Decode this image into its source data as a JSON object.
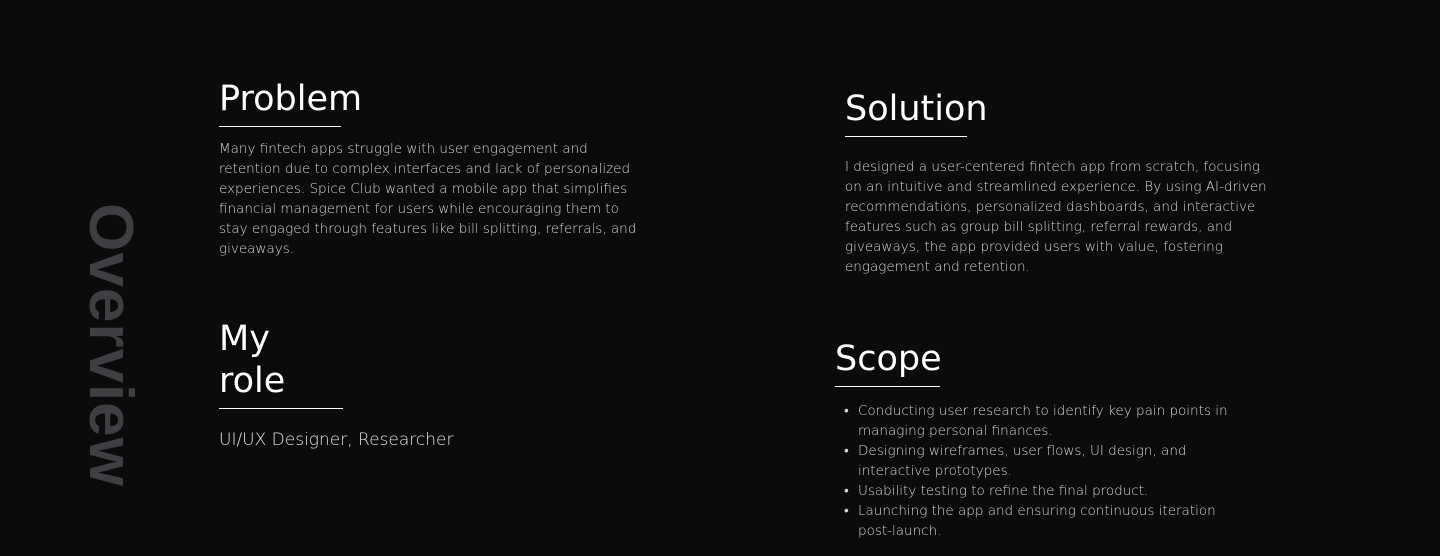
{
  "side_title": "Overview",
  "problem": {
    "heading": "Problem",
    "body": "Many fintech apps struggle with user engagement and retention due to complex interfaces and lack of personalized experiences. Spice Club wanted a mobile app that simplifies financial management for users while encouraging them to stay engaged through features like bill splitting, referrals, and giveaways."
  },
  "solution": {
    "heading": "Solution",
    "body": "I designed a user-centered fintech app from scratch, focusing on an intuitive and streamlined experience. By using AI-driven recommendations, personalized dashboards, and interactive features such as group bill splitting, referral rewards, and giveaways, the app provided users with value, fostering engagement and retention."
  },
  "role": {
    "heading": "My role",
    "text": "UI/UX Designer, Researcher"
  },
  "scope": {
    "heading": "Scope",
    "bullet": "•",
    "items": [
      "Conducting user research to identify key pain points in managing personal finances.",
      "Designing wireframes, user flows, UI design, and interactive prototypes.",
      "Usability testing to refine the final product.",
      "Launching the app and ensuring continuous iteration post-launch."
    ]
  },
  "colors": {
    "background": "#0b0b0c",
    "heading": "#ffffff",
    "body_text": "#d6d6d6",
    "side_title": "#3e3e43"
  }
}
